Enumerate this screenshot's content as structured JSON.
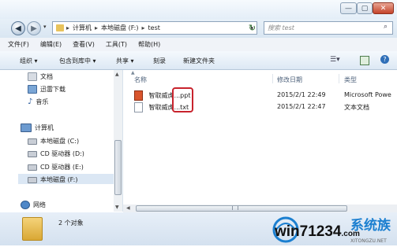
{
  "window": {
    "minimize_glyph": "—",
    "maximize_glyph": "▢",
    "close_glyph": "✕"
  },
  "address": {
    "segments": [
      "计算机",
      "本地磁盘 (F:)",
      "test"
    ],
    "search_placeholder": "搜索 test"
  },
  "menubar": {
    "items": [
      "文件(F)",
      "编辑(E)",
      "查看(V)",
      "工具(T)",
      "帮助(H)"
    ]
  },
  "toolbar": {
    "organize": "组织 ▾",
    "include": "包含到库中 ▾",
    "share": "共享 ▾",
    "burn": "刻录",
    "new_folder": "新建文件夹"
  },
  "sidebar": {
    "libraries": [
      "文档",
      "迅雷下载",
      "音乐"
    ],
    "computer": "计算机",
    "drives": [
      "本地磁盘 (C:)",
      "CD 驱动器 (D:)",
      "CD 驱动器 (E:)",
      "本地磁盘 (F:)"
    ],
    "network": "网络"
  },
  "columns": {
    "name": "名称",
    "modified": "修改日期",
    "type": "类型"
  },
  "files": [
    {
      "name": "智取威虎...ppt",
      "modified": "2015/2/1 22:49",
      "type": "Microsoft Powe"
    },
    {
      "name": "智取威虎...txt",
      "modified": "2015/2/1 22:47",
      "type": "文本文档"
    }
  ],
  "details": {
    "count": "2 个对象"
  },
  "watermark": {
    "text": "win7",
    "number": "1234",
    "tld": ".com",
    "brand": "系统族",
    "sub": "XITONGZU.NET"
  },
  "colors": {
    "highlight_box": "#c8232d",
    "selection": "#dbe7f4"
  }
}
